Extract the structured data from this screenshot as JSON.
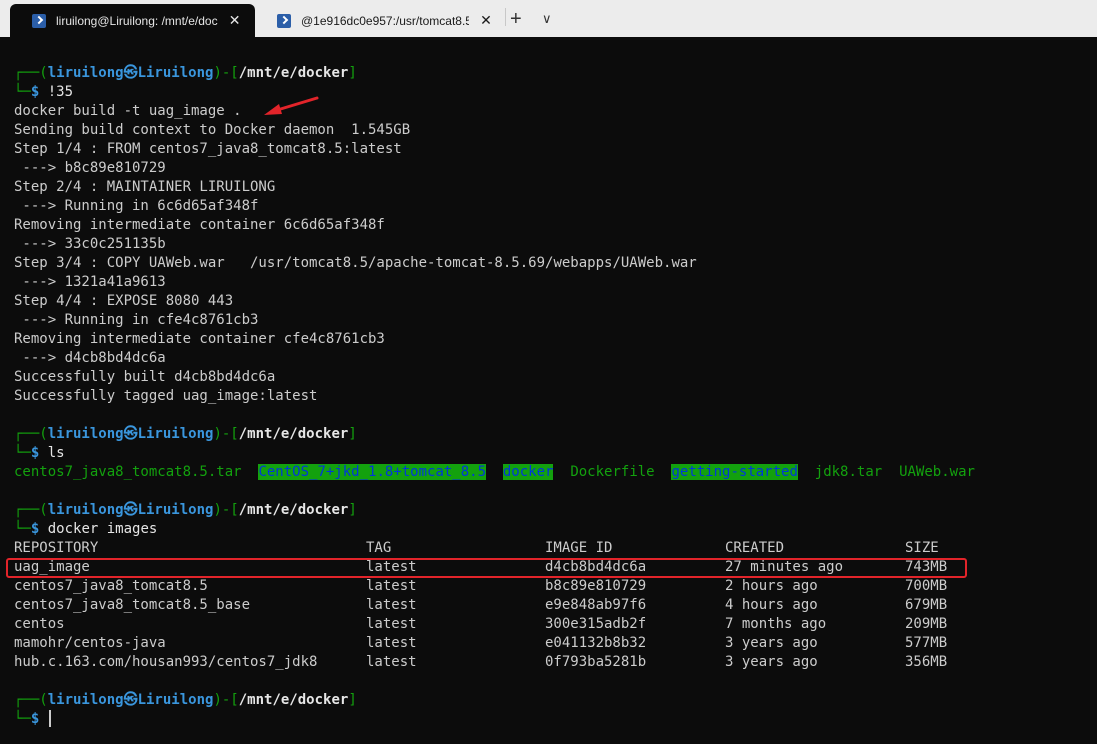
{
  "tabs": [
    {
      "title": "liruilong@Liruilong: /mnt/e/doc",
      "close": "✕"
    },
    {
      "title": "@1e916dc0e957:/usr/tomcat8.5",
      "close": "✕"
    }
  ],
  "tab_controls": {
    "new": "+",
    "dropdown": "∨"
  },
  "prompts": [
    {
      "user": "liruilong",
      "sep": "㉿",
      "host": "Liruilong",
      "path": "/mnt/e/docker",
      "command": "!35"
    },
    {
      "user": "liruilong",
      "sep": "㉿",
      "host": "Liruilong",
      "path": "/mnt/e/docker",
      "command": "ls"
    },
    {
      "user": "liruilong",
      "sep": "㉿",
      "host": "Liruilong",
      "path": "/mnt/e/docker",
      "command": "docker images"
    },
    {
      "user": "liruilong",
      "sep": "㉿",
      "host": "Liruilong",
      "path": "/mnt/e/docker",
      "command": ""
    }
  ],
  "build_output": [
    "docker build -t uag_image .",
    "Sending build context to Docker daemon  1.545GB",
    "Step 1/4 : FROM centos7_java8_tomcat8.5:latest",
    " ---> b8c89e810729",
    "Step 2/4 : MAINTAINER LIRUILONG",
    " ---> Running in 6c6d65af348f",
    "Removing intermediate container 6c6d65af348f",
    " ---> 33c0c251135b",
    "Step 3/4 : COPY UAWeb.war   /usr/tomcat8.5/apache-tomcat-8.5.69/webapps/UAWeb.war",
    " ---> 1321a41a9613",
    "Step 4/4 : EXPOSE 8080 443",
    " ---> Running in cfe4c8761cb3",
    "Removing intermediate container cfe4c8761cb3",
    " ---> d4cb8bd4dc6a",
    "Successfully built d4cb8bd4dc6a",
    "Successfully tagged uag_image:latest"
  ],
  "ls_output": [
    {
      "name": "centos7_java8_tomcat8.5.tar",
      "kind": "file"
    },
    {
      "name": "CentOS_7+jkd_1.8+tomcat_8.5",
      "kind": "dir-hl"
    },
    {
      "name": "docker",
      "kind": "dir-hl"
    },
    {
      "name": "Dockerfile",
      "kind": "file"
    },
    {
      "name": "getting-started",
      "kind": "dir-hl"
    },
    {
      "name": "jdk8.tar",
      "kind": "file"
    },
    {
      "name": "UAWeb.war",
      "kind": "file"
    }
  ],
  "images_table": {
    "headers": [
      "REPOSITORY",
      "TAG",
      "IMAGE ID",
      "CREATED",
      "SIZE"
    ],
    "rows": [
      [
        "uag_image",
        "latest",
        "d4cb8bd4dc6a",
        "27 minutes ago",
        "743MB"
      ],
      [
        "centos7_java8_tomcat8.5",
        "latest",
        "b8c89e810729",
        "2 hours ago",
        "700MB"
      ],
      [
        "centos7_java8_tomcat8.5_base",
        "latest",
        "e9e848ab97f6",
        "4 hours ago",
        "679MB"
      ],
      [
        "centos",
        "latest",
        "300e315adb2f",
        "7 months ago",
        "209MB"
      ],
      [
        "mamohr/centos-java",
        "latest",
        "e041132b8b32",
        "3 years ago",
        "577MB"
      ],
      [
        "hub.c.163.com/housan993/centos7_jdk8",
        "latest",
        "0f793ba5281b",
        "3 years ago",
        "356MB"
      ]
    ]
  },
  "colors": {
    "terminal_bg": "#0c0c0c",
    "prompt_blue": "#3a96dd",
    "prompt_green": "#13a10e",
    "annotation_red": "#e2242a"
  }
}
